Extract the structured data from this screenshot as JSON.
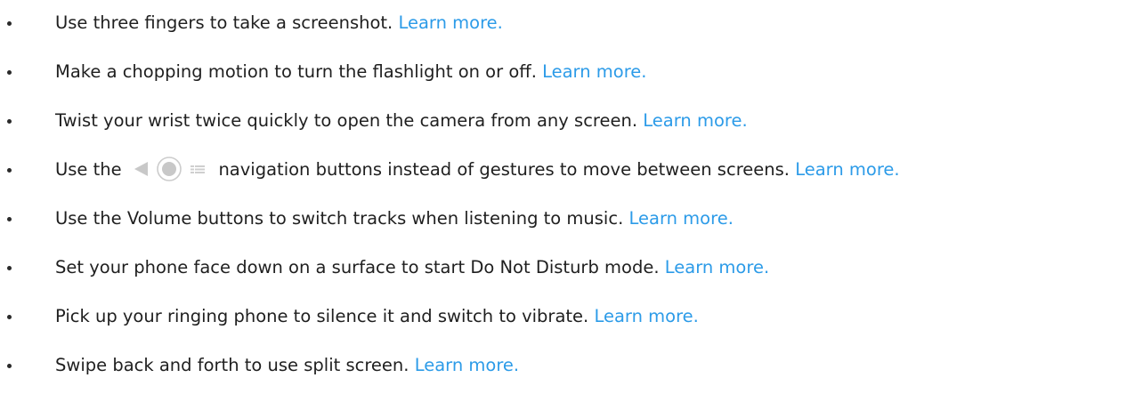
{
  "tips": [
    {
      "text": "Use three fingers to take a screenshot.",
      "link": "Learn more."
    },
    {
      "text": "Make a chopping motion to turn the flashlight on or off.",
      "link": "Learn more."
    },
    {
      "text": "Twist your wrist twice quickly to open the camera from any screen.",
      "link": "Learn more."
    },
    {
      "text_before": "Use the",
      "text_after": "navigation buttons instead of gestures to move between screens.",
      "link": "Learn more."
    },
    {
      "text": "Use the Volume buttons to switch tracks when listening to music.",
      "link": "Learn more."
    },
    {
      "text": "Set your phone face down on a surface to start Do Not Disturb mode.",
      "link": "Learn more."
    },
    {
      "text": "Pick up your ringing phone to silence it and switch to vibrate.",
      "link": "Learn more."
    },
    {
      "text": "Swipe back and forth to use split screen.",
      "link": "Learn more."
    }
  ],
  "icons": {
    "back": "back-triangle-icon",
    "home": "home-circle-icon",
    "recents": "recents-icon"
  },
  "colors": {
    "link": "#2c9be8",
    "text": "#1f1f1f",
    "nav_icon": "#c8c8c8"
  }
}
